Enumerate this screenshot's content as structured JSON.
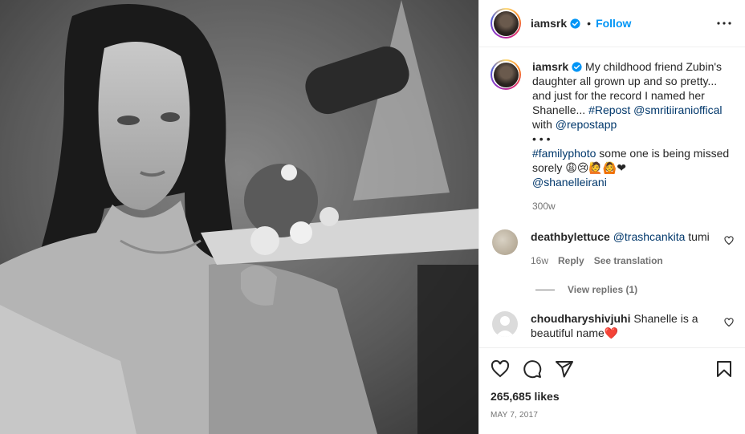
{
  "post": {
    "username": "iamsrk",
    "dot": "•",
    "follow_label": "Follow",
    "photo_icon": "family-photo-image"
  },
  "caption": {
    "username": "iamsrk",
    "text_parts": {
      "p1": " My childhood friend Zubin's daughter all grown up and so pretty... and just for the record I named her Shanelle... ",
      "repost": "#Repost",
      "sp1": " ",
      "smriti": "@smritiiranioffical",
      "with": " with ",
      "repostapp": "@repostapp",
      "dots": "• • •",
      "familyphoto": "#familyphoto",
      "p2": " some one is being missed sorely 😩😢🙋🙆❤",
      "shanelle": "@shanelleirani"
    },
    "time": "300w"
  },
  "comments": [
    {
      "username": "deathbylettuce",
      "mention": "@trashcankita",
      "text": " tumi",
      "time": "16w",
      "reply_label": "Reply",
      "translate_label": "See translation"
    },
    {
      "username": "choudharyshivjuhi",
      "text": " Shanelle is a beautiful name❤️"
    }
  ],
  "view_replies": "View replies (1)",
  "likes": "265,685 likes",
  "date": "MAY 7, 2017",
  "colors": {
    "accent": "#0095f6",
    "link": "#00376b",
    "muted": "#737373"
  }
}
